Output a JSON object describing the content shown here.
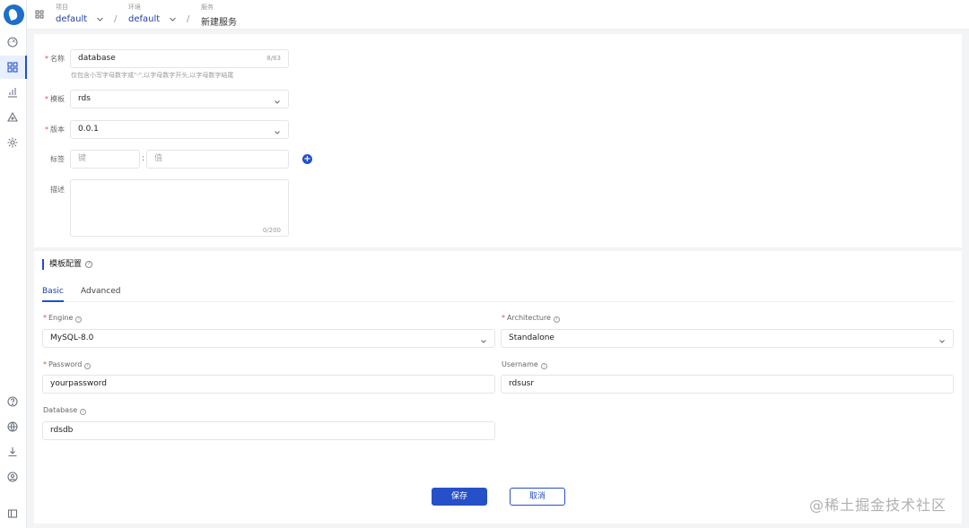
{
  "breadcrumb": {
    "project": {
      "caption": "项目",
      "value": "default"
    },
    "env": {
      "caption": "环境",
      "value": "default"
    },
    "service": {
      "caption": "服务",
      "value": "新建服务"
    },
    "sep": "/"
  },
  "form": {
    "name": {
      "label": "名称",
      "value": "database",
      "counter": "8/63",
      "hint": "仅包含小写字母数字或\"-\",以字母数字开头,以字母数字结尾"
    },
    "template": {
      "label": "模板",
      "value": "rds"
    },
    "version": {
      "label": "版本",
      "value": "0.0.1"
    },
    "tags": {
      "label": "标签",
      "key_placeholder": "键",
      "colon": ":",
      "value_placeholder": "值",
      "add_symbol": "+"
    },
    "description": {
      "label": "描述",
      "counter": "0/200"
    },
    "required_mark": "*"
  },
  "template_config": {
    "title": "模板配置",
    "help_symbol": "?",
    "tabs": [
      "Basic",
      "Advanced"
    ],
    "active_tab": "Basic",
    "info_symbol": "i",
    "fields": {
      "engine": {
        "label": "Engine",
        "value": "MySQL-8.0"
      },
      "architecture": {
        "label": "Architecture",
        "value": "Standalone"
      },
      "password": {
        "label": "Password",
        "value": "yourpassword"
      },
      "username": {
        "label": "Username",
        "value": "rdsusr"
      },
      "database": {
        "label": "Database",
        "value": "rdsdb"
      }
    }
  },
  "actions": {
    "save": "保存",
    "cancel": "取消"
  },
  "watermark": "@稀土掘金技术社区",
  "colors": {
    "primary": "#2650c8",
    "required": "#e5484d",
    "logo": "#1e6fc8"
  }
}
